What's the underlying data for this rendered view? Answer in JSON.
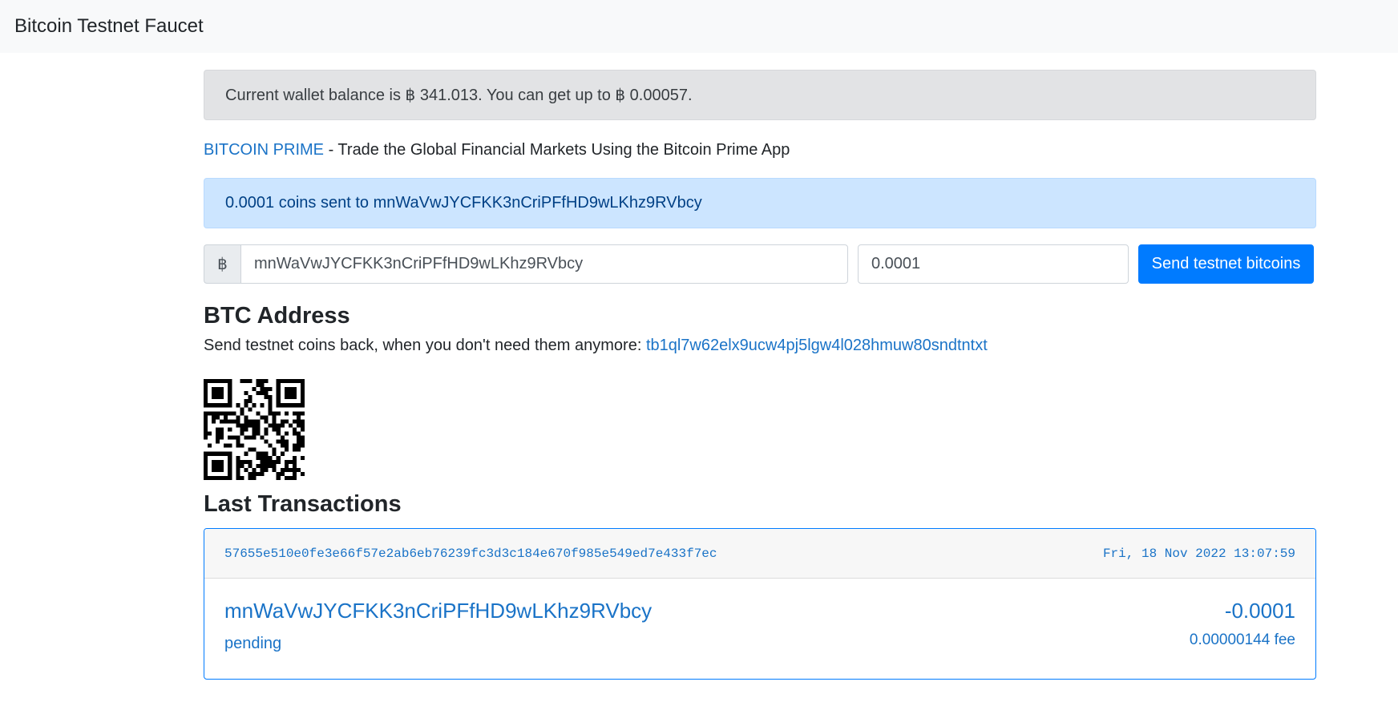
{
  "navbar": {
    "brand": "Bitcoin Testnet Faucet"
  },
  "balance_alert": {
    "text": "Current wallet balance is ฿ 341.013. You can get up to ฿ 0.00057."
  },
  "promo": {
    "link_text": "BITCOIN PRIME",
    "text": " - Trade the Global Financial Markets Using the Bitcoin Prime App"
  },
  "sent_alert": {
    "text": "0.0001 coins sent to mnWaVwJYCFKK3nCriPFfHD9wLKhz9RVbcy"
  },
  "form": {
    "currency_symbol": "฿",
    "address_value": "mnWaVwJYCFKK3nCriPFfHD9wLKhz9RVbcy",
    "amount_value": "0.0001",
    "submit_label": "Send testnet bitcoins"
  },
  "btc_address": {
    "heading": "BTC Address",
    "text": "Send testnet coins back, when you don't need them anymore: ",
    "address": "tb1ql7w62elx9ucw4pj5lgw4l028hmuw80sndtntxt"
  },
  "transactions": {
    "heading": "Last Transactions",
    "items": [
      {
        "txid": "57655e510e0fe3e66f57e2ab6eb76239fc3d3c184e670f985e549ed7e433f7ec",
        "date": "Fri, 18 Nov 2022 13:07:59",
        "address": "mnWaVwJYCFKK3nCriPFfHD9wLKhz9RVbcy",
        "status": "pending",
        "amount": "-0.0001",
        "fee": "0.00000144 fee"
      }
    ]
  },
  "colors": {
    "link": "#1a73c7",
    "primary": "#007bff",
    "info_bg": "#cce5ff",
    "secondary_bg": "#e2e3e5"
  }
}
